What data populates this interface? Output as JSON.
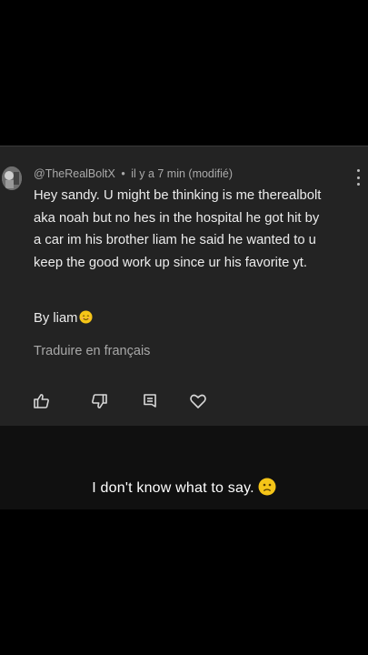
{
  "comment": {
    "author": "@TheRealBoltX",
    "separator": "•",
    "time": "il y a 7 min (modifié)",
    "body_lines": [
      "Hey sandy. U might be thinking is me therealbolt",
      "aka noah but no hes in the hospital he got hit by",
      "a car im his brother liam he said he wanted to u",
      "keep the good work up since ur his favorite yt."
    ],
    "signoff": "By liam",
    "signoff_emoji": "smiling-face-emoji",
    "translate_label": "Traduire en français",
    "actions": [
      "like-icon",
      "dislike-icon",
      "reply-icon",
      "heart-icon"
    ]
  },
  "caption": {
    "text": "I don't know what to say.",
    "emoji": "sad-face-emoji"
  },
  "colors": {
    "background": "#000000",
    "card": "#232323",
    "lower_panel": "#101010",
    "text": "#ececec",
    "muted": "#a8a8a8",
    "emoji": "#f5c518"
  }
}
